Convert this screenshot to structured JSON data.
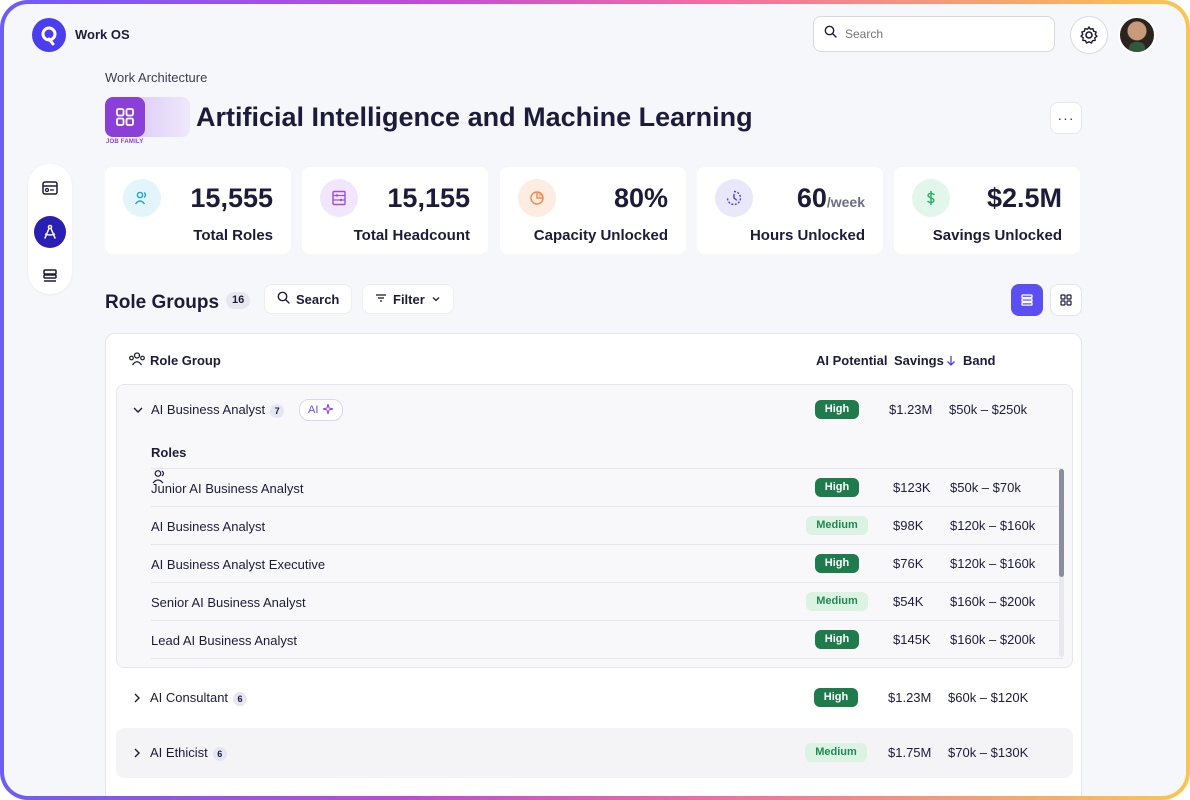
{
  "app": {
    "name": "Work OS"
  },
  "search": {
    "placeholder": "Search"
  },
  "header": {
    "breadcrumb": "Work Architecture",
    "badge_label": "JOB FAMILY",
    "title": "Artificial Intelligence and Machine Learning",
    "more_label": "···"
  },
  "stats": [
    {
      "value": "15,555",
      "unit": "",
      "label": "Total Roles",
      "icon": "users-icon",
      "color": "#1aa6c8",
      "bg": "#e3f5fa"
    },
    {
      "value": "15,155",
      "unit": "",
      "label": "Total Headcount",
      "icon": "abacus-icon",
      "color": "#9b4fd6",
      "bg": "#f1e6fb"
    },
    {
      "value": "80%",
      "unit": "",
      "label": "Capacity Unlocked",
      "icon": "pie-chart-icon",
      "color": "#f08a4b",
      "bg": "#fdece2"
    },
    {
      "value": "60",
      "unit": "/week",
      "label": "Hours Unlocked",
      "icon": "clock-icon",
      "color": "#4b3df0",
      "bg": "#e9e8fb"
    },
    {
      "value": "$2.5M",
      "unit": "",
      "label": "Savings Unlocked",
      "icon": "dollar-icon",
      "color": "#2fae6b",
      "bg": "#e3f6ec"
    }
  ],
  "role_groups": {
    "title": "Role Groups",
    "count": "16",
    "search_label": "Search",
    "filter_label": "Filter",
    "columns": {
      "role_group": "Role Group",
      "ai_potential": "AI Potential",
      "savings": "Savings",
      "band": "Band"
    },
    "expanded_group": {
      "name": "AI Business Analyst",
      "count": "7",
      "tag": "AI",
      "potential": "High",
      "savings": "$1.23M",
      "band": "$50k – $250k",
      "roles_label": "Roles",
      "roles": [
        {
          "name": "Junior AI Business Analyst",
          "potential": "High",
          "savings": "$123K",
          "band": "$50k – $70k"
        },
        {
          "name": "AI Business Analyst",
          "potential": "Medium",
          "savings": "$98K",
          "band": "$120k – $160k"
        },
        {
          "name": "AI Business Analyst Executive",
          "potential": "High",
          "savings": "$76K",
          "band": "$120k – $160k"
        },
        {
          "name": "Senior AI Business Analyst",
          "potential": "Medium",
          "savings": "$54K",
          "band": "$160k – $200k"
        },
        {
          "name": "Lead AI Business Analyst",
          "potential": "High",
          "savings": "$145K",
          "band": "$160k – $200k"
        }
      ]
    },
    "collapsed_groups": [
      {
        "name": "AI Consultant",
        "count": "6",
        "potential": "High",
        "savings": "$1.23M",
        "band": "$60k – $120K"
      },
      {
        "name": "AI Ethicist",
        "count": "6",
        "potential": "Medium",
        "savings": "$1.75M",
        "band": "$70k – $130K"
      }
    ]
  }
}
